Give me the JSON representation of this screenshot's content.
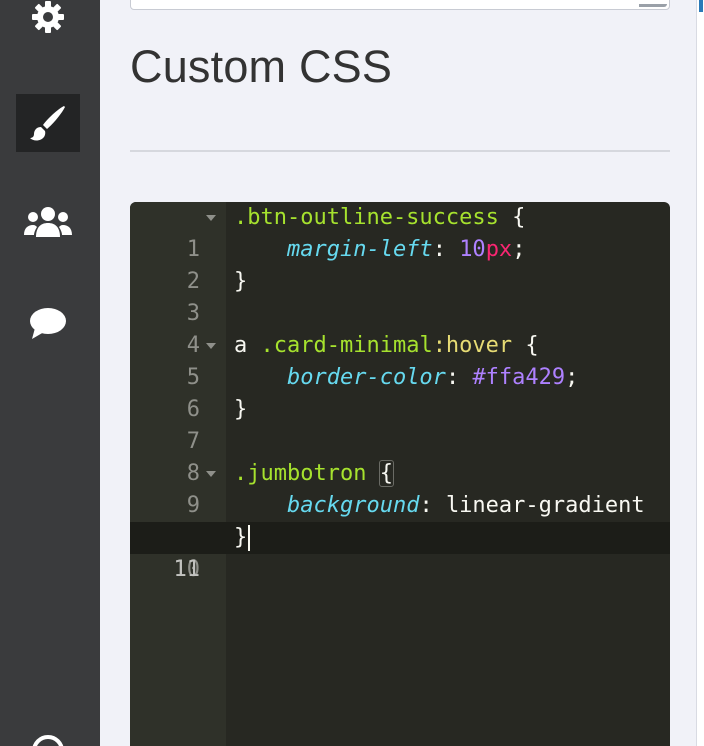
{
  "page": {
    "title": "Custom CSS"
  },
  "sidebar": {
    "items": [
      {
        "name": "settings",
        "icon": "gear-icon",
        "active": false
      },
      {
        "name": "custom-css",
        "icon": "paintbrush-icon",
        "active": true
      },
      {
        "name": "users",
        "icon": "users-icon",
        "active": false
      },
      {
        "name": "comments",
        "icon": "comment-icon",
        "active": false
      }
    ]
  },
  "editor": {
    "theme": "monokai",
    "colors": {
      "background": "#272822",
      "gutter": "#2f3129",
      "selector": "#a6e22e",
      "property": "#66d9ef",
      "number": "#ae81ff",
      "unit": "#f92672",
      "pseudo": "#e6db74",
      "text": "#f8f8f2"
    },
    "lines": [
      {
        "num": "1",
        "fold": true
      },
      {
        "num": "2",
        "fold": false
      },
      {
        "num": "3",
        "fold": false
      },
      {
        "num": "4",
        "fold": false
      },
      {
        "num": "5",
        "fold": true
      },
      {
        "num": "6",
        "fold": false
      },
      {
        "num": "7",
        "fold": false
      },
      {
        "num": "8",
        "fold": false
      },
      {
        "num": "9",
        "fold": true
      },
      {
        "num": "10",
        "fold": false,
        "warning": true
      },
      {
        "num": "11",
        "fold": false,
        "active": true
      }
    ],
    "code": {
      "l1_selector": ".btn-outline-success",
      "l1_brace": " {",
      "l2_indent": "    ",
      "l2_prop": "margin-left",
      "l2_colon": ": ",
      "l2_num": "10",
      "l2_unit": "px",
      "l2_semi": ";",
      "l3": "}",
      "l5_tag": "a ",
      "l5_class": ".card-minimal",
      "l5_pseudo": ":hover",
      "l5_brace": " {",
      "l6_indent": "    ",
      "l6_prop": "border-color",
      "l6_colon": ": ",
      "l6_value": "#ffa429",
      "l6_semi": ";",
      "l7": "}",
      "l9_selector": ".jumbotron",
      "l9_space": " ",
      "l9_brace": "{",
      "l10_indent": "    ",
      "l10_prop": "background",
      "l10_colon": ": ",
      "l10_value": "linear-gradient",
      "l11": "}"
    }
  }
}
